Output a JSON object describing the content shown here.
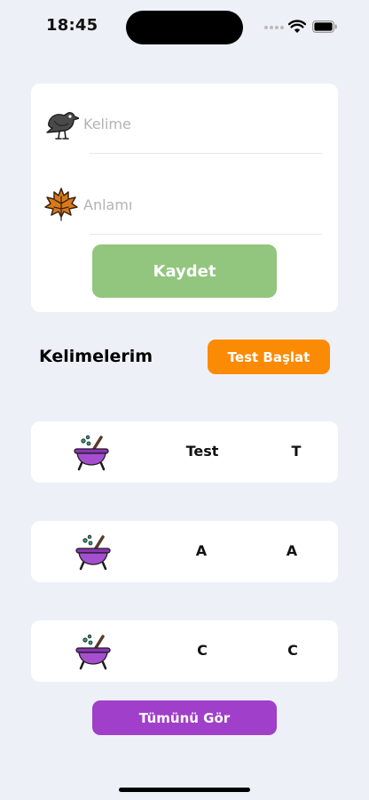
{
  "status_bar": {
    "time": "18:45"
  },
  "form": {
    "word_placeholder": "Kelime",
    "word_value": "",
    "word_icon": "crow-icon",
    "meaning_placeholder": "Anlamı",
    "meaning_value": "",
    "meaning_icon": "leaf-icon",
    "save_label": "Kaydet",
    "save_color": "#92c57d"
  },
  "words_section": {
    "title": "Kelimelerim",
    "start_test_label": "Test Başlat",
    "start_test_color": "#fb8a05"
  },
  "word_list": [
    {
      "icon": "cauldron-icon",
      "word": "Test",
      "meaning": "T"
    },
    {
      "icon": "cauldron-icon",
      "word": "A",
      "meaning": "A"
    },
    {
      "icon": "cauldron-icon",
      "word": "C",
      "meaning": "C"
    }
  ],
  "show_all_label": "Tümünü Gör",
  "show_all_color": "#a03fc9"
}
